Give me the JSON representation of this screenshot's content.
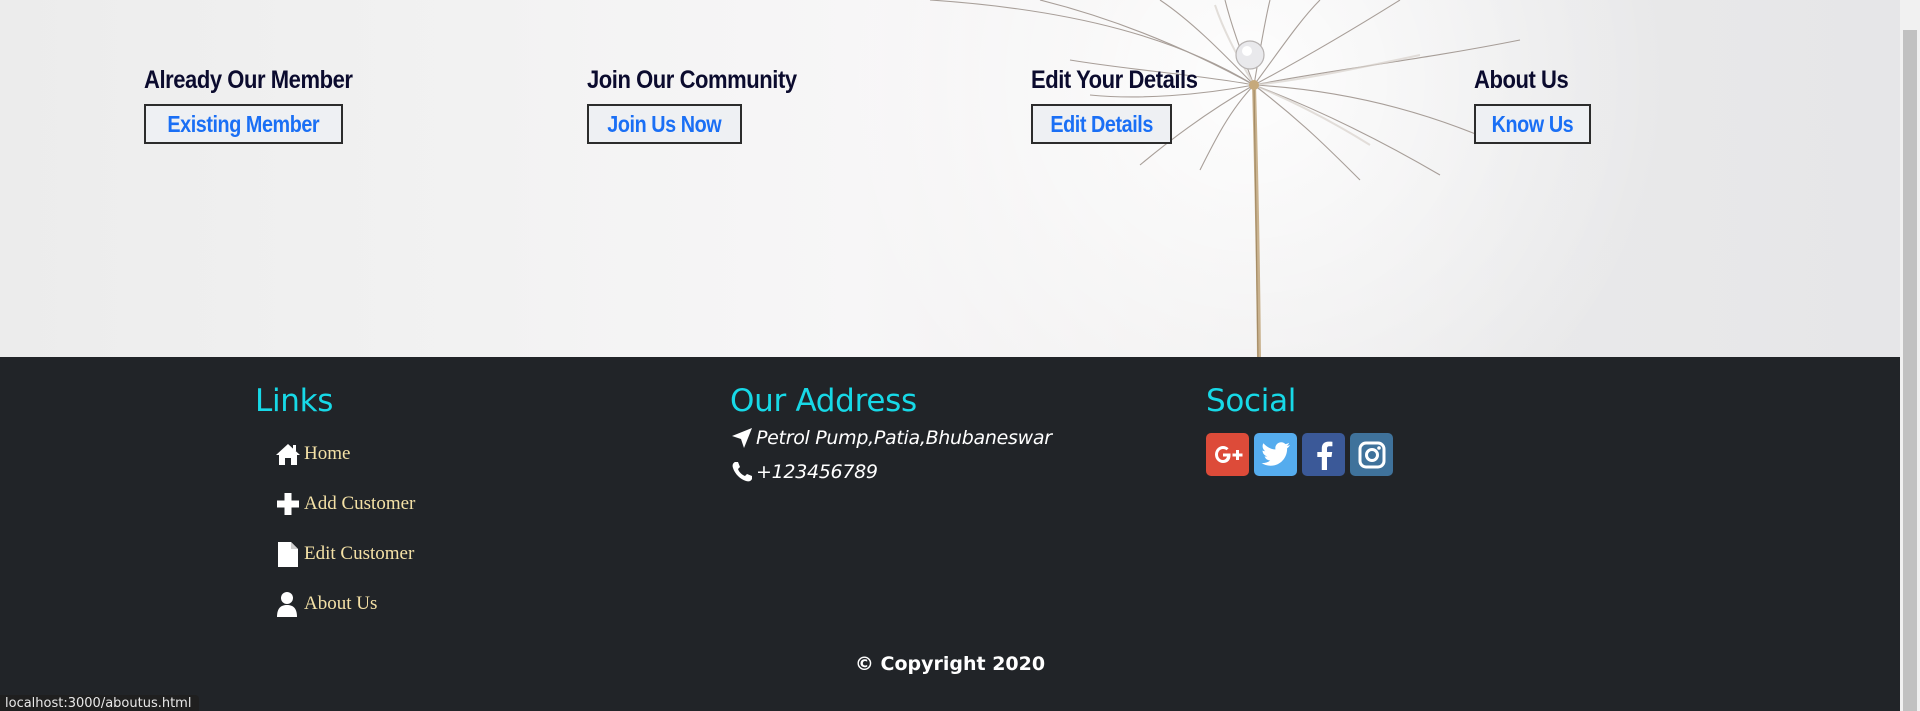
{
  "cta": [
    {
      "heading": "Already Our Member",
      "button": "Existing Member"
    },
    {
      "heading": "Join Our Community",
      "button": "Join Us Now"
    },
    {
      "heading": "Edit Your Details",
      "button": "Edit Details"
    },
    {
      "heading": "About Us",
      "button": "Know Us"
    }
  ],
  "footer": {
    "links": {
      "heading": "Links",
      "items": [
        {
          "label": "Home",
          "icon": "home-icon"
        },
        {
          "label": "Add Customer",
          "icon": "plus-icon"
        },
        {
          "label": "Edit Customer",
          "icon": "file-icon"
        },
        {
          "label": "About Us",
          "icon": "user-icon"
        }
      ]
    },
    "address": {
      "heading": "Our Address",
      "location": "Petrol Pump,Patia,Bhubaneswar",
      "phone": "+123456789"
    },
    "social": {
      "heading": "Social",
      "items": [
        {
          "name": "google-plus",
          "color": "#dd4b39"
        },
        {
          "name": "twitter",
          "color": "#55acee"
        },
        {
          "name": "facebook",
          "color": "#3b5998"
        },
        {
          "name": "instagram",
          "color": "#3f729b"
        }
      ]
    },
    "copyright": "© Copyright 2020"
  },
  "status_bar": {
    "url": "localhost:3000/aboutus.html"
  },
  "colors": {
    "footer_bg": "#212428",
    "heading_cyan": "#17d9e7",
    "link_gold": "#f4e1a6",
    "button_blue": "#1a6ff5"
  }
}
